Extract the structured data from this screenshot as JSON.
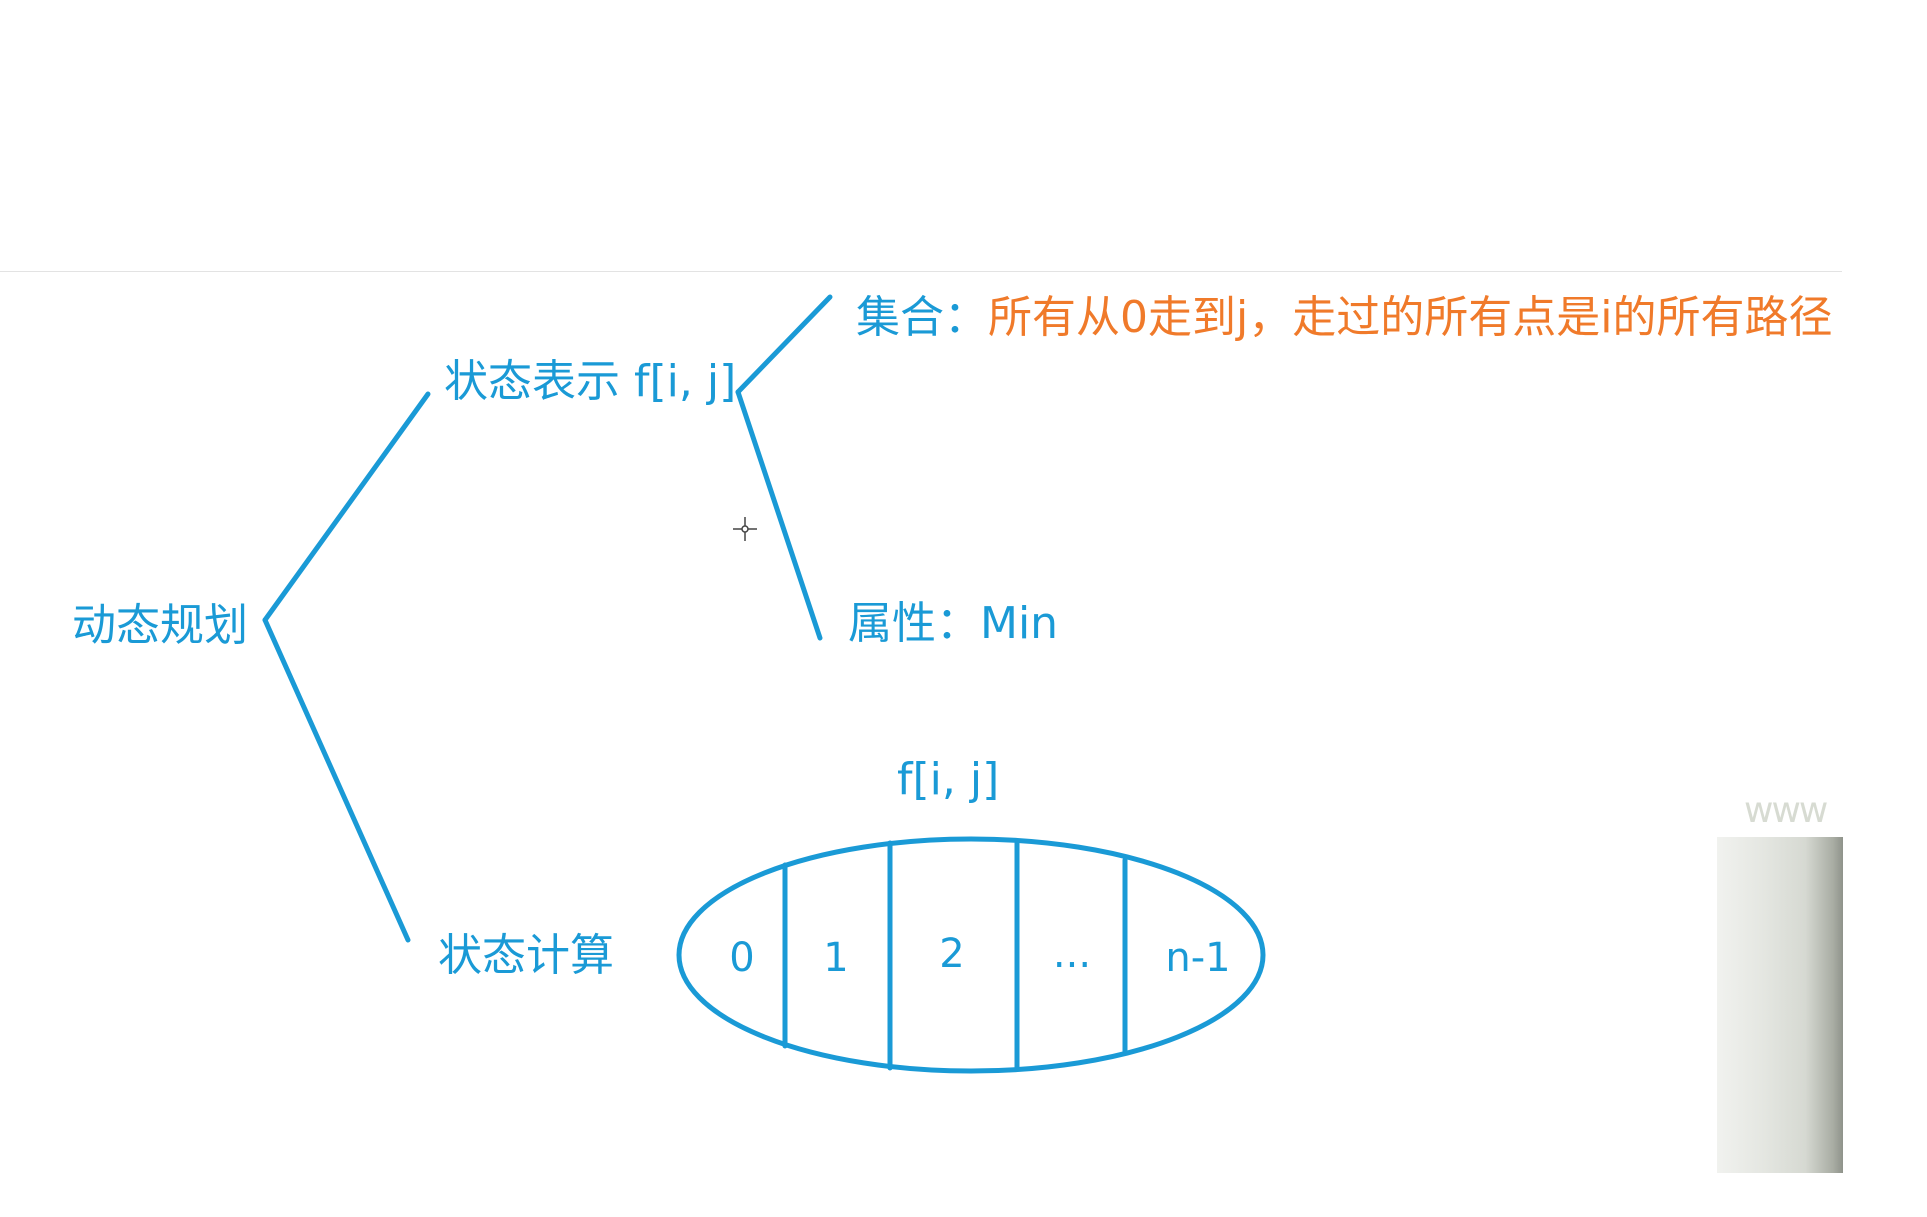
{
  "root": {
    "label": "动态规划"
  },
  "state_representation": {
    "label": "状态表示 f[i, j]"
  },
  "set": {
    "label": "集合：",
    "description": "所有从0走到j，走过的所有点是i的所有路径"
  },
  "attribute": {
    "label": "属性：Min"
  },
  "state_computation": {
    "label": "状态计算"
  },
  "partition": {
    "title": "f[i, j]",
    "cells": [
      "0",
      "1",
      "2",
      "...",
      "n-1"
    ]
  },
  "watermark": {
    "text": "www"
  },
  "colors": {
    "blue": "#1a9ad6",
    "orange": "#f07a2a"
  }
}
